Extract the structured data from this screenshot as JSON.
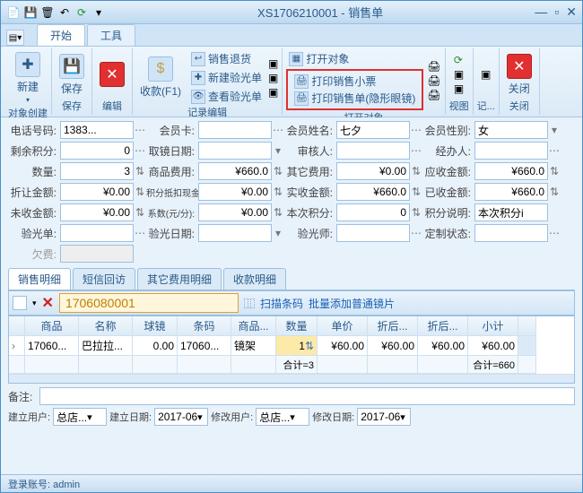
{
  "window_title": "XS1706210001 - 销售单",
  "tabs": {
    "start": "开始",
    "tools": "工具"
  },
  "ribbon": {
    "group_create": "对象创建",
    "new": "新建",
    "group_save": "保存",
    "save": "保存",
    "group_edit": "编辑",
    "group_record": "记录编辑",
    "receive": "收款(F1)",
    "return": "销售退货",
    "new_optometry": "新建验光单",
    "view_optometry": "查看验光单",
    "group_open": "打开对象",
    "open_obj": "打开对象",
    "print_receipt": "打印销售小票",
    "print_sales": "打印销售单(隐形眼镜)",
    "group_view": "视图",
    "group_rec": "记...",
    "group_close": "关闭",
    "close": "关闭"
  },
  "fields": {
    "phone_l": "电话号码:",
    "phone_v": "1383...",
    "card_l": "会员卡:",
    "mname_l": "会员姓名:",
    "mname_v": "七夕",
    "msex_l": "会员性别:",
    "msex_v": "女",
    "rempts_l": "剩余积分:",
    "rempts_v": "0",
    "getdate_l": "取镜日期:",
    "reviewer_l": "审核人:",
    "handler_l": "经办人:",
    "qty_l": "数量:",
    "qty_v": "3",
    "goodsfee_l": "商品费用:",
    "goodsfee_v": "¥660.0",
    "otherfee_l": "其它费用:",
    "otherfee_v": "¥0.00",
    "due_l": "应收金额:",
    "due_v": "¥660.0",
    "discount_l": "折让金额:",
    "discount_v": "¥0.00",
    "ptscash_l": "积分抵扣现金:",
    "ptscash_v": "¥0.00",
    "actual_l": "实收金额:",
    "actual_v": "¥660.0",
    "paid_l": "已收金额:",
    "paid_v": "¥660.0",
    "unpaid_l": "未收金额:",
    "unpaid_v": "¥0.00",
    "coef_l": "系数(元/分):",
    "coef_v": "¥0.00",
    "thispts_l": "本次积分:",
    "thispts_v": "0",
    "ptsdesc_l": "积分说明:",
    "ptsdesc_v": "本次积分i",
    "optom_l": "验光单:",
    "optdate_l": "验光日期:",
    "optometrist_l": "验光师:",
    "customstat_l": "定制状态:",
    "owed_l": "欠费:"
  },
  "subtabs": {
    "detail": "销售明细",
    "sms": "短信回访",
    "other": "其它费用明细",
    "receipt": "收款明细"
  },
  "detail": {
    "code": "1706080001",
    "scan": "扫描条码",
    "batch": "批量添加普通镜片",
    "cols": [
      "商品",
      "名称",
      "球镜",
      "条码",
      "商品...",
      "数量",
      "单价",
      "折后...",
      "折后...",
      "小计"
    ],
    "row": {
      "code": "17060...",
      "name": "巴拉拉...",
      "sph": "0.00",
      "barcode": "17060...",
      "cat": "镜架",
      "qty": "1",
      "price": "¥60.00",
      "disc1": "¥60.00",
      "disc2": "¥60.00",
      "subtotal": "¥60.00"
    },
    "sum_qty": "合计=3",
    "sum_total": "合计=660"
  },
  "remark_l": "备注:",
  "creator_l": "建立用户:",
  "creator_v": "总店...",
  "cdate_l": "建立日期:",
  "cdate_v": "2017-06",
  "modifier_l": "修改用户:",
  "modifier_v": "总店...",
  "mdate_l": "修改日期:",
  "mdate_v": "2017-06",
  "status": "登录账号: admin"
}
